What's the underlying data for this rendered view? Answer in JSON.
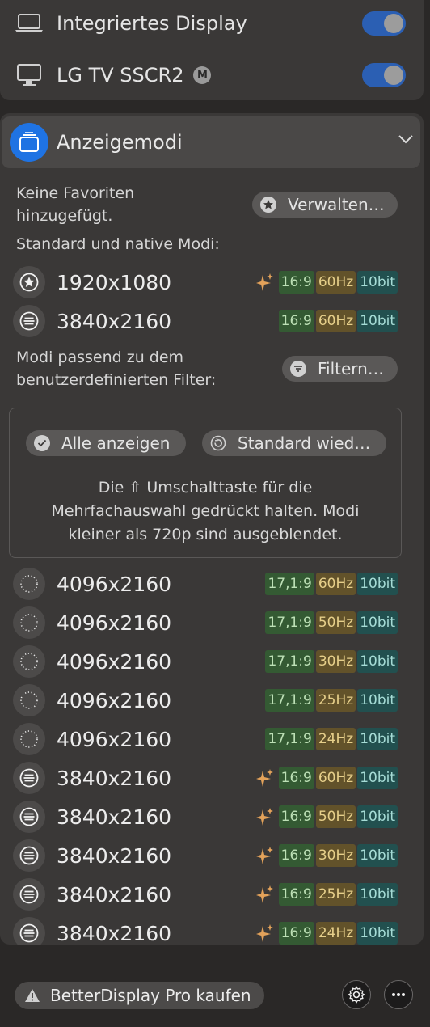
{
  "displays": [
    {
      "name": "Integriertes Display",
      "icon": "laptop-icon",
      "enabled": true,
      "badge": ""
    },
    {
      "name": "LG TV SSCR2",
      "icon": "monitor-icon",
      "enabled": true,
      "badge": "M"
    }
  ],
  "section": {
    "title": "Anzeigemodi",
    "icon": "display-modes-icon"
  },
  "favorites": {
    "empty_text": "Keine Favoriten hinzugefügt.",
    "manage_label": "Verwalten…"
  },
  "standard_modes_heading": "Standard und native Modi:",
  "standard_modes": [
    {
      "resolution": "1920x1080",
      "icon": "star-icon",
      "sparkle": true,
      "ratio": "16:9",
      "hz": "60Hz",
      "bit": "10bit"
    },
    {
      "resolution": "3840x2160",
      "icon": "list-icon",
      "sparkle": false,
      "ratio": "16:9",
      "hz": "60Hz",
      "bit": "10bit"
    }
  ],
  "filter": {
    "heading": "Modi passend zu dem benutzerdefinierten Filter:",
    "button_label": "Filtern…",
    "show_all_label": "Alle anzeigen",
    "reset_label": "Standard wied…",
    "info": "Die ⇧ Umschalttaste für die Mehrfachauswahl gedrückt halten. Modi kleiner als 720p sind ausgeblendet."
  },
  "filtered_modes": [
    {
      "resolution": "4096x2160",
      "icon": "dotted-circle-icon",
      "sparkle": false,
      "ratio": "17,1:9",
      "hz": "60Hz",
      "bit": "10bit"
    },
    {
      "resolution": "4096x2160",
      "icon": "dotted-circle-icon",
      "sparkle": false,
      "ratio": "17,1:9",
      "hz": "50Hz",
      "bit": "10bit"
    },
    {
      "resolution": "4096x2160",
      "icon": "dotted-circle-icon",
      "sparkle": false,
      "ratio": "17,1:9",
      "hz": "30Hz",
      "bit": "10bit"
    },
    {
      "resolution": "4096x2160",
      "icon": "dotted-circle-icon",
      "sparkle": false,
      "ratio": "17,1:9",
      "hz": "25Hz",
      "bit": "10bit"
    },
    {
      "resolution": "4096x2160",
      "icon": "dotted-circle-icon",
      "sparkle": false,
      "ratio": "17,1:9",
      "hz": "24Hz",
      "bit": "10bit"
    },
    {
      "resolution": "3840x2160",
      "icon": "list-icon",
      "sparkle": true,
      "ratio": "16:9",
      "hz": "60Hz",
      "bit": "10bit"
    },
    {
      "resolution": "3840x2160",
      "icon": "list-icon",
      "sparkle": true,
      "ratio": "16:9",
      "hz": "50Hz",
      "bit": "10bit"
    },
    {
      "resolution": "3840x2160",
      "icon": "list-icon",
      "sparkle": true,
      "ratio": "16:9",
      "hz": "30Hz",
      "bit": "10bit"
    },
    {
      "resolution": "3840x2160",
      "icon": "list-icon",
      "sparkle": true,
      "ratio": "16:9",
      "hz": "25Hz",
      "bit": "10bit"
    },
    {
      "resolution": "3840x2160",
      "icon": "list-icon",
      "sparkle": true,
      "ratio": "16:9",
      "hz": "24Hz",
      "bit": "10bit"
    }
  ],
  "footer": {
    "buy_label": "BetterDisplay Pro kaufen",
    "settings_icon": "gear-icon",
    "more_icon": "ellipsis-icon"
  },
  "colors": {
    "accent": "#1f73e3",
    "toggle_on": "#2b5fb3",
    "sparkle": "#e3a25a"
  }
}
